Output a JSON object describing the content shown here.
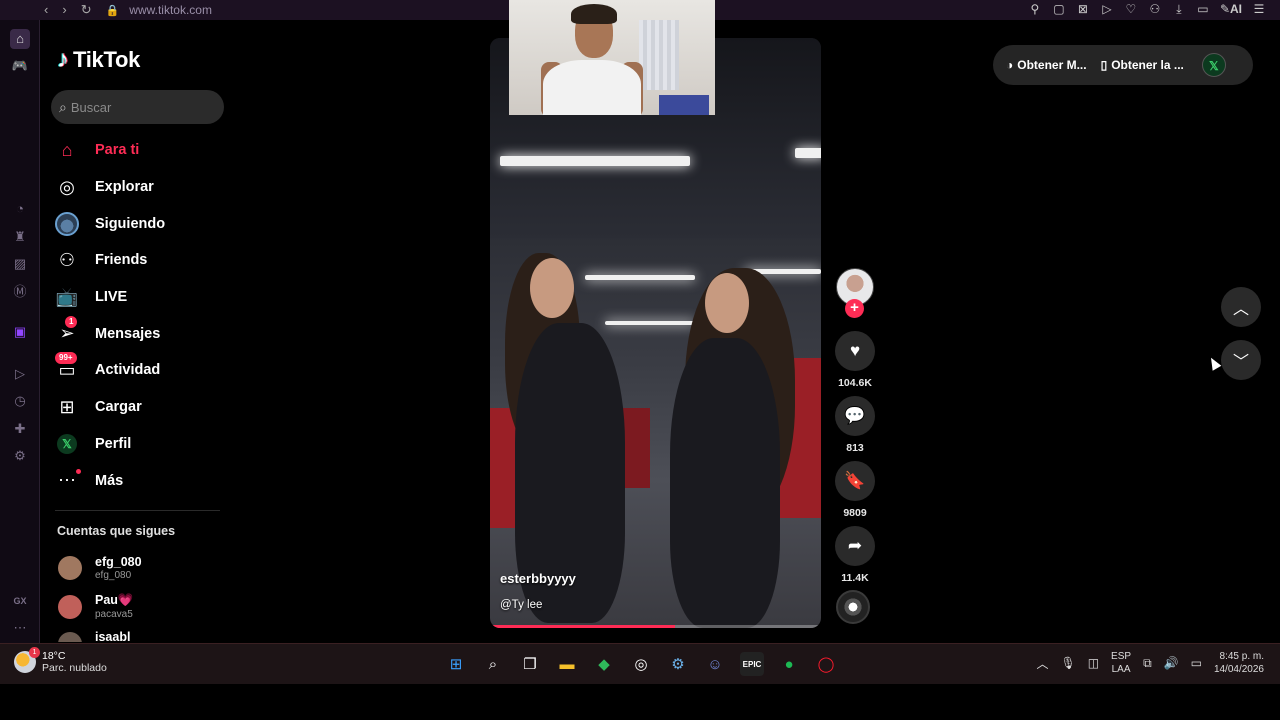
{
  "browser": {
    "url": "www.tiktok.com",
    "icons": [
      "back-icon",
      "forward-icon",
      "reload-icon",
      "lock-icon"
    ],
    "right_icons": [
      "pin-icon",
      "snapshot-icon",
      "adblock-icon",
      "player-icon",
      "heart-icon",
      "account-icon",
      "download-icon",
      "battery-icon",
      "aria-icon",
      "menu-icon"
    ],
    "ai_label": "AI"
  },
  "app": {
    "logo": "TikTok"
  },
  "search": {
    "placeholder": "Buscar"
  },
  "menu": {
    "items": [
      {
        "label": "Para ti",
        "icon": "home-icon",
        "active": true
      },
      {
        "label": "Explorar",
        "icon": "compass-icon"
      },
      {
        "label": "Siguiendo",
        "icon": "following-avatar-icon"
      },
      {
        "label": "Friends",
        "icon": "friends-icon"
      },
      {
        "label": "LIVE",
        "icon": "live-tv-icon"
      },
      {
        "label": "Mensajes",
        "icon": "messages-icon",
        "badge": "1"
      },
      {
        "label": "Actividad",
        "icon": "activity-icon",
        "badge": "99+"
      },
      {
        "label": "Cargar",
        "icon": "upload-icon"
      },
      {
        "label": "Perfil",
        "icon": "profile-icon"
      },
      {
        "label": "Más",
        "icon": "more-icon"
      }
    ]
  },
  "following": {
    "title": "Cuentas que sigues",
    "accounts": [
      {
        "name": "efg_080",
        "username": "efg_080"
      },
      {
        "name": "Pau💗",
        "username": "pacava5"
      },
      {
        "name": "isaabl",
        "username": ""
      }
    ]
  },
  "video": {
    "author": "esterbbyyyy",
    "sound": "@Ty lee",
    "progress_fraction": 0.56
  },
  "actions": {
    "likes": "104.6K",
    "comments": "813",
    "saves": "9809",
    "shares": "11.4K"
  },
  "top_right": {
    "get_app_1": "Obtener M...",
    "get_app_2": "Obtener la ..."
  },
  "taskbar": {
    "temp": "18°C",
    "weather": "Parc. nublado",
    "weather_badge": "1",
    "lang_1": "ESP",
    "lang_2": "LAA",
    "time": "8:45 p. m.",
    "date": "14/04/2026"
  },
  "colors": {
    "accent": "#fe2c55",
    "background": "#000000",
    "panel": "#2a2a2a"
  }
}
